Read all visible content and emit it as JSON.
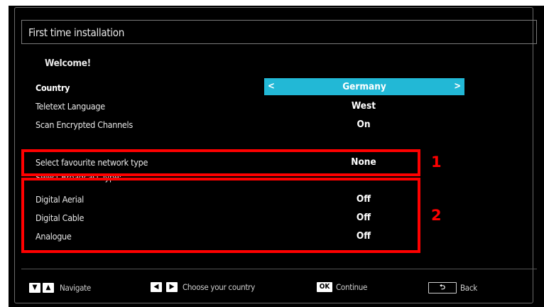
{
  "window": {
    "title": "First time installation"
  },
  "welcome": "Welcome!",
  "settings": {
    "country": {
      "label": "Country",
      "value": "Germany"
    },
    "teletext": {
      "label": "Teletext Language",
      "value": "West"
    },
    "encrypted": {
      "label": "Scan Encrypted Channels",
      "value": "On"
    },
    "network": {
      "label": "Select favourite network type",
      "value": "None"
    },
    "broadcast_header": "Select Broadcast Type:",
    "aerial": {
      "label": "Digital Aerial",
      "value": "Off"
    },
    "cable": {
      "label": "Digital Cable",
      "value": "Off"
    },
    "analogue": {
      "label": "Analogue",
      "value": "Off"
    }
  },
  "annotations": {
    "one": "1",
    "two": "2"
  },
  "footer": {
    "navigate": "Navigate",
    "choose": "Choose your country",
    "ok_key": "OK",
    "continue": "Continue",
    "back": "Back"
  },
  "colors": {
    "highlight": "#22b8d6",
    "annotation": "#ff0000",
    "background": "#000000"
  }
}
